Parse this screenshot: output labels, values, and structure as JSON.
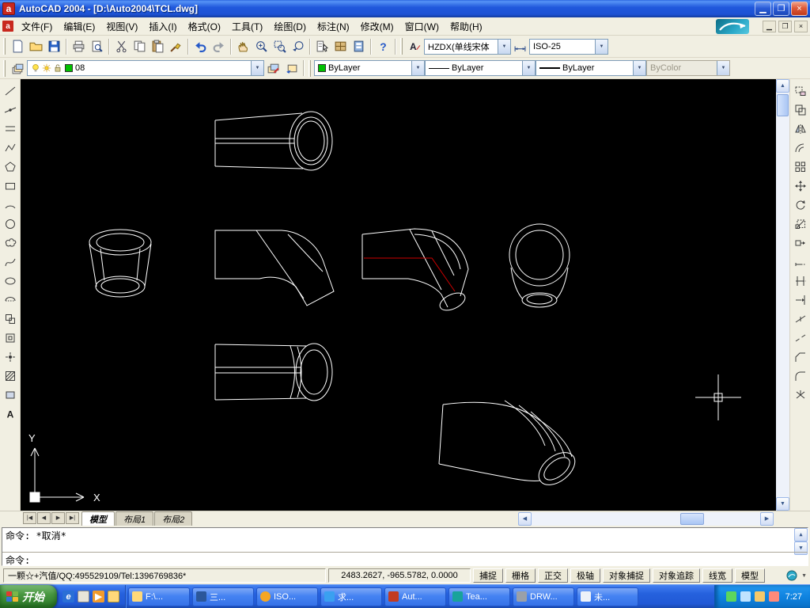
{
  "window": {
    "title": "AutoCAD 2004 - [D:\\Auto2004\\TCL.dwg]"
  },
  "menu_bar": {
    "items": [
      "文件(F)",
      "编辑(E)",
      "视图(V)",
      "插入(I)",
      "格式(O)",
      "工具(T)",
      "绘图(D)",
      "标注(N)",
      "修改(M)",
      "窗口(W)",
      "帮助(H)"
    ]
  },
  "standard_toolbar": {
    "icons": [
      "new",
      "open",
      "save",
      "plot",
      "plot-preview",
      "cut",
      "copy",
      "paste",
      "match-properties",
      "undo",
      "redo",
      "pan",
      "zoom-realtime",
      "zoom-window",
      "zoom-previous",
      "properties",
      "designcenter",
      "tool-palettes",
      "help"
    ]
  },
  "styles_toolbar": {
    "text_style": "HZDX(单线宋体",
    "dim_style": "ISO-25"
  },
  "layers_toolbar": {
    "current_layer": "08",
    "layer_color": "#00c000"
  },
  "properties_toolbar": {
    "color": "ByLayer",
    "linetype": "ByLayer",
    "lineweight": "ByLayer",
    "plot_style": "ByColor"
  },
  "draw_toolbar": {
    "icons": [
      "line",
      "construction-line",
      "multiline",
      "polyline",
      "polygon",
      "rectangle",
      "arc",
      "circle",
      "revision-cloud",
      "spline",
      "ellipse",
      "ellipse-arc",
      "insert-block",
      "make-block",
      "point",
      "hatch",
      "region",
      "multiline-text"
    ]
  },
  "modify_toolbar": {
    "icons": [
      "erase",
      "copy-object",
      "mirror",
      "offset",
      "array",
      "move",
      "rotate",
      "scale",
      "stretch",
      "lengthen",
      "trim",
      "extend",
      "break-at-point",
      "break",
      "chamfer",
      "fillet",
      "explode"
    ]
  },
  "layout_tabs": {
    "items": [
      "模型",
      "布局1",
      "布局2"
    ],
    "active": "模型"
  },
  "command_window": {
    "history": "命令: *取消*",
    "prompt": "命令:"
  },
  "status_bar": {
    "left_text": "一颗☆+汽值/QQ:495529109/Tel:1396769836*",
    "coordinates": "2483.2627, -965.5782, 0.0000",
    "toggles": [
      "捕捉",
      "栅格",
      "正交",
      "极轴",
      "对象捕捉",
      "对象追踪",
      "线宽",
      "模型"
    ]
  },
  "taskbar": {
    "start": "开始",
    "tasks": [
      "F:\\...",
      "三...",
      "ISO...",
      "求...",
      "Aut...",
      "Tea...",
      "DRW...",
      "未..."
    ],
    "clock": "7:27"
  },
  "ucs": {
    "x": "X",
    "y": "Y"
  },
  "colors": {
    "canvas": "#000000",
    "line": "#ffffff",
    "centerline": "#cc0000",
    "titlebar": "#1c5ee1",
    "taskbar": "#2663e0",
    "start_green": "#3c873a"
  }
}
